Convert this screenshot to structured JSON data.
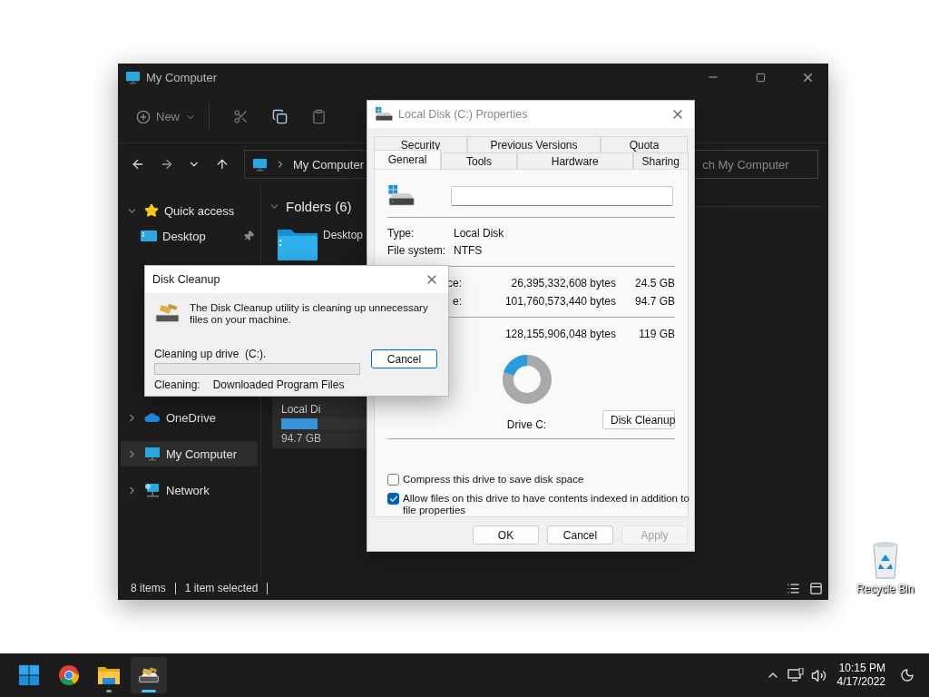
{
  "explorer": {
    "title": "My Computer",
    "toolbar": {
      "new_label": "New"
    },
    "address": "My Computer",
    "search": {
      "placeholder": "ch My Computer"
    },
    "sidebar": {
      "items": [
        {
          "kind": "quick",
          "label": "Quick access",
          "expanded": true,
          "selected": false,
          "children": [
            {
              "kind": "desktop",
              "label": "Desktop",
              "pinned": true,
              "selected": false
            }
          ]
        },
        {
          "kind": "cloud",
          "label": "OneDrive",
          "expanded": false,
          "selected": false
        },
        {
          "kind": "computer",
          "label": "My Computer",
          "expanded": false,
          "selected": true
        },
        {
          "kind": "network",
          "label": "Network",
          "expanded": false,
          "selected": false
        }
      ]
    },
    "content": {
      "heading": "Folders (6)",
      "expanded": true,
      "items": [
        {
          "kind": "folder",
          "label": "Desktop",
          "selected": false
        },
        {
          "kind": "drive",
          "label": "Local Di",
          "detail": "94.7 GB",
          "level": 0.2,
          "selected": true
        }
      ]
    },
    "status_bar": {
      "count": "8 items",
      "selection": "1 item selected"
    }
  },
  "properties": {
    "title": "Local Disk (C:) Properties",
    "tab_rows": [
      {
        "tabs": [
          {
            "label": "Security",
            "selected": false
          },
          {
            "label": "Previous Versions",
            "selected": false
          },
          {
            "label": "Quota",
            "selected": false
          }
        ]
      },
      {
        "tabs": [
          {
            "label": "General",
            "selected": true
          },
          {
            "label": "Tools",
            "selected": false
          },
          {
            "label": "Hardware",
            "selected": false
          },
          {
            "label": "Sharing",
            "selected": false
          }
        ]
      }
    ],
    "info": [
      {
        "label": "Type:",
        "value": "Local Disk"
      },
      {
        "label": "File system:",
        "value": "NTFS"
      }
    ],
    "sizes": [
      {
        "label": "ce:",
        "bytes": "26,395,332,608 bytes",
        "size": "24.5 GB"
      },
      {
        "label": "e:",
        "bytes": "101,760,573,440 bytes",
        "size": "94.7 GB"
      }
    ],
    "capacity": {
      "bytes": "128,155,906,048 bytes",
      "size": "119 GB"
    },
    "drive_label": "Drive C:",
    "cleanup_button": "Disk Cleanup",
    "options": [
      {
        "label": "Compress this drive to save disk space",
        "checked": false
      },
      {
        "label": "Allow files on this drive to have contents indexed in addition to file properties",
        "checked": true
      }
    ],
    "buttons": [
      {
        "label": "OK",
        "disabled": false
      },
      {
        "label": "Cancel",
        "disabled": false
      },
      {
        "label": "Apply",
        "disabled": true
      }
    ]
  },
  "cleanup": {
    "title": "Disk Cleanup",
    "message": "The Disk Cleanup utility is cleaning up unnecessary files on your machine.",
    "status": "Cleaning up drive  (C:).",
    "current_label": "Cleaning:",
    "current_item": "Downloaded Program Files",
    "button": "Cancel"
  },
  "desktop": {
    "icons": [
      {
        "label": "Recycle Bin"
      }
    ]
  },
  "taskbar": {
    "apps": [
      {
        "kind": "start",
        "selected": false
      },
      {
        "kind": "chrome",
        "selected": false
      },
      {
        "kind": "explorer",
        "open": true,
        "selected": false
      },
      {
        "kind": "cleanup",
        "open": true,
        "selected": true
      }
    ],
    "time": "10:15 PM",
    "date": "4/17/2022"
  }
}
